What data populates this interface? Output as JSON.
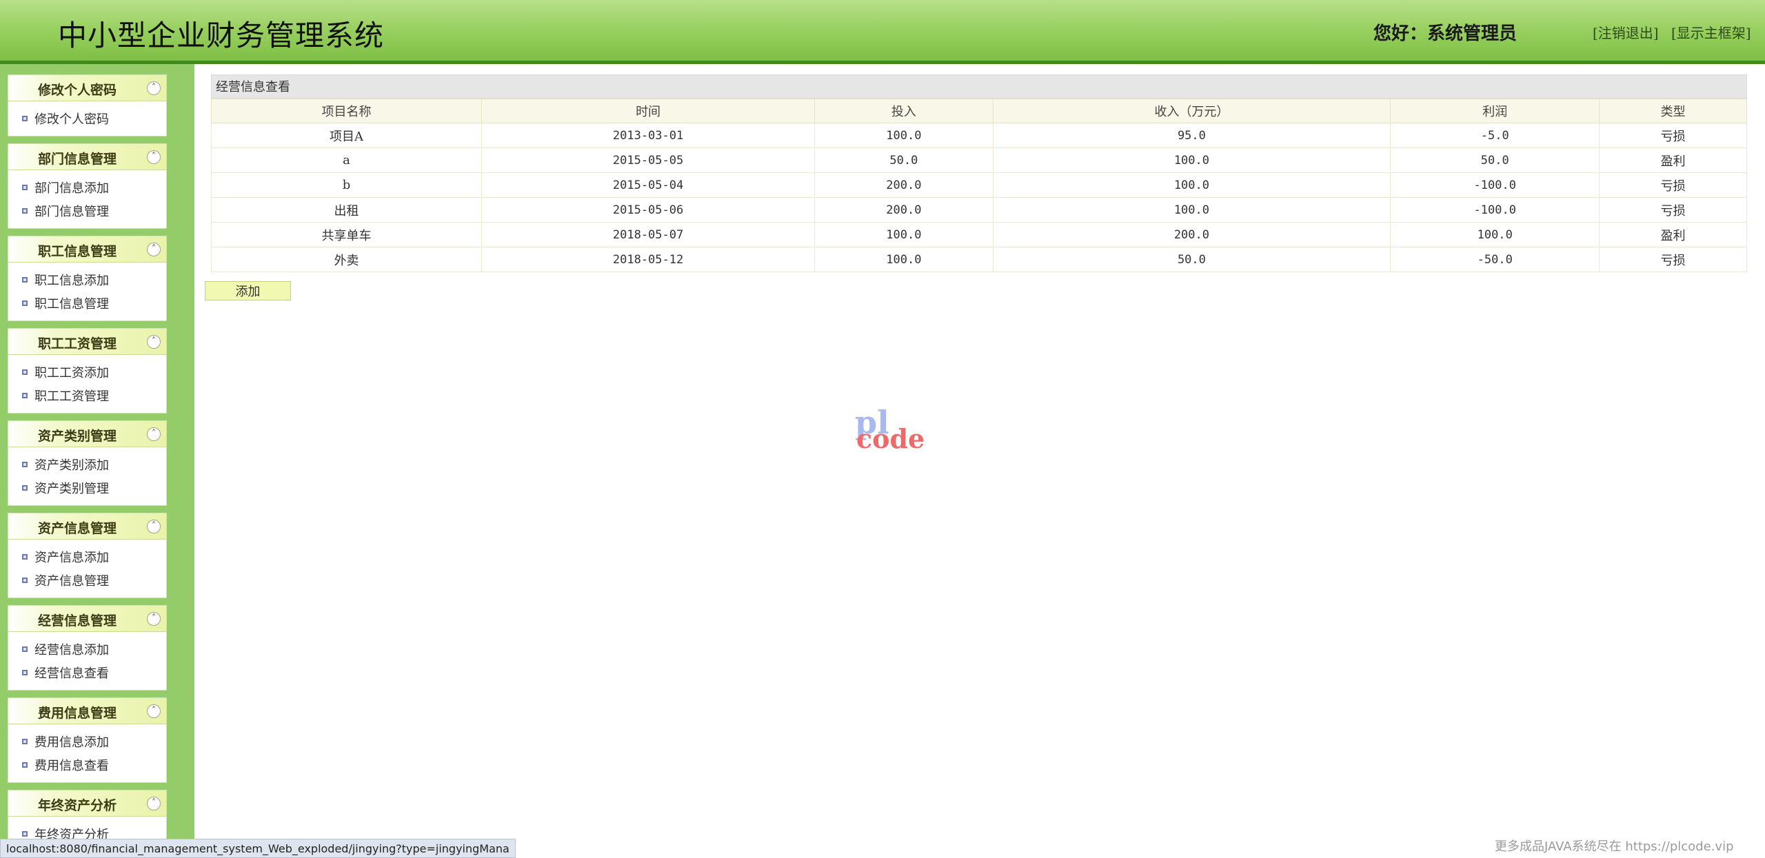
{
  "header": {
    "title": "中小型企业财务管理系统",
    "greeting": "您好：系统管理员",
    "logout": "[注销退出]",
    "show_frame": "[显示主框架]"
  },
  "sidebar": {
    "groups": [
      {
        "title": "修改个人密码",
        "items": [
          "修改个人密码"
        ]
      },
      {
        "title": "部门信息管理",
        "items": [
          "部门信息添加",
          "部门信息管理"
        ]
      },
      {
        "title": "职工信息管理",
        "items": [
          "职工信息添加",
          "职工信息管理"
        ]
      },
      {
        "title": "职工工资管理",
        "items": [
          "职工工资添加",
          "职工工资管理"
        ]
      },
      {
        "title": "资产类别管理",
        "items": [
          "资产类别添加",
          "资产类别管理"
        ]
      },
      {
        "title": "资产信息管理",
        "items": [
          "资产信息添加",
          "资产信息管理"
        ]
      },
      {
        "title": "经营信息管理",
        "items": [
          "经营信息添加",
          "经营信息查看"
        ]
      },
      {
        "title": "费用信息管理",
        "items": [
          "费用信息添加",
          "费用信息查看"
        ]
      },
      {
        "title": "年终资产分析",
        "items": [
          "年终资产分析"
        ]
      }
    ]
  },
  "main": {
    "panel_title": "经营信息查看",
    "columns": [
      "项目名称",
      "时间",
      "投入",
      "收入（万元）",
      "利润",
      "类型"
    ],
    "rows": [
      [
        "项目A",
        "2013-03-01",
        "100.0",
        "95.0",
        "-5.0",
        "亏损"
      ],
      [
        "a",
        "2015-05-05",
        "50.0",
        "100.0",
        "50.0",
        "盈利"
      ],
      [
        "b",
        "2015-05-04",
        "200.0",
        "100.0",
        "-100.0",
        "亏损"
      ],
      [
        "出租",
        "2015-05-06",
        "200.0",
        "100.0",
        "-100.0",
        "亏损"
      ],
      [
        "共享单车",
        "2018-05-07",
        "100.0",
        "200.0",
        "100.0",
        "盈利"
      ],
      [
        "外卖",
        "2018-05-12",
        "100.0",
        "50.0",
        "-50.0",
        "亏损"
      ]
    ],
    "add_button": "添加"
  },
  "watermark": {
    "pl": "pl",
    "code": "code"
  },
  "status_url": "localhost:8080/financial_management_system_Web_exploded/jingying?type=jingyingMana",
  "footer_note": "更多成品JAVA系统尽在 https://plcode.vip"
}
